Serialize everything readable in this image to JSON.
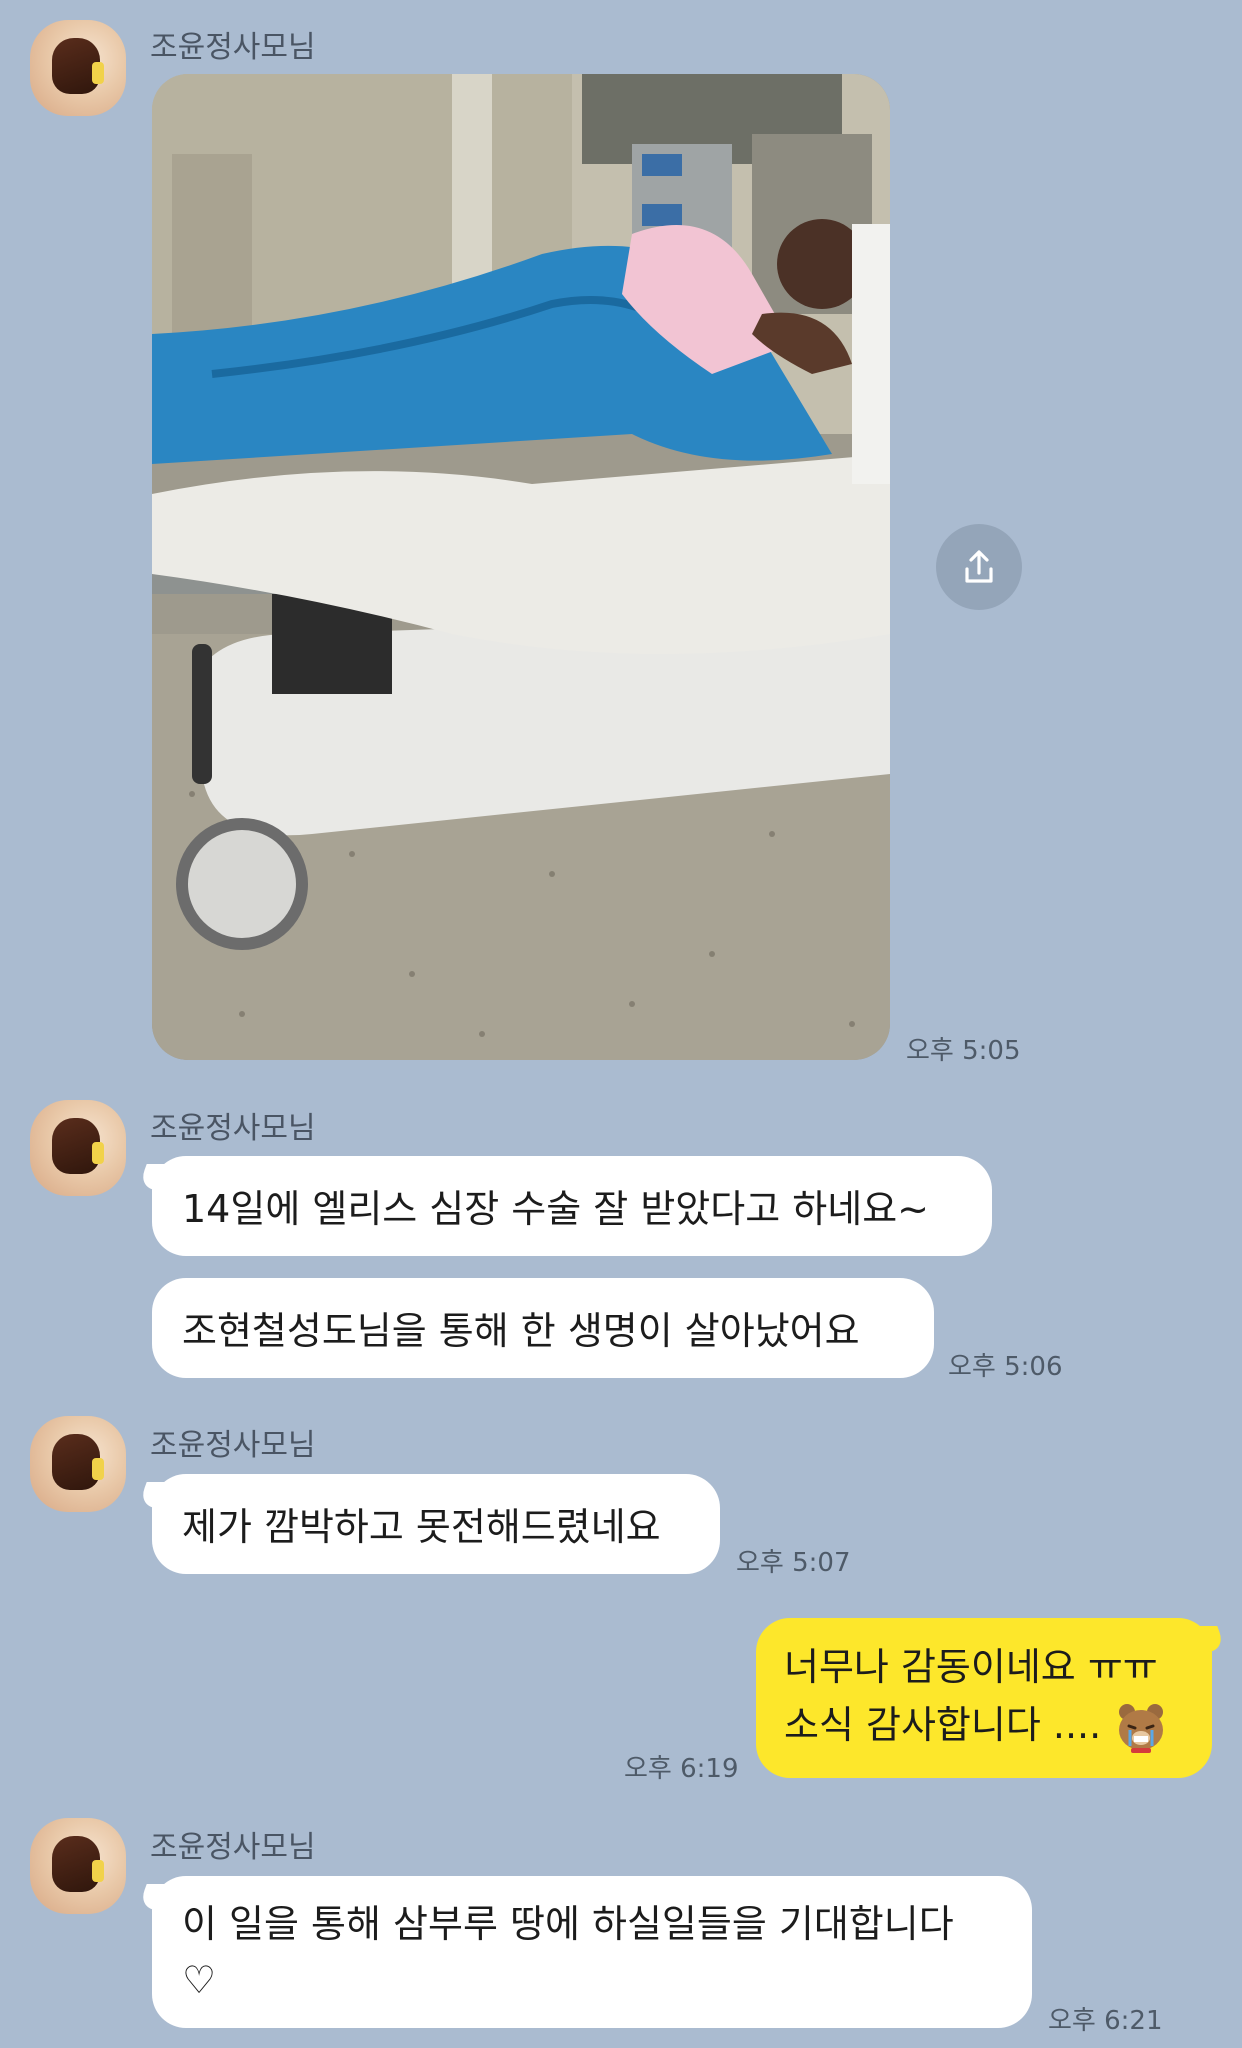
{
  "chat": {
    "sender_name": "조윤정사모님",
    "messages": [
      {
        "type": "image",
        "time": "오후 5:05"
      },
      {
        "lines": [
          "14일에 엘리스 심장 수술 잘 받았다고 하네요~"
        ]
      },
      {
        "lines": [
          "조현철성도님을 통해 한 생명이 살아났어요"
        ],
        "time": "오후 5:06"
      },
      {
        "lines": [
          "제가 깜박하고 못전해드렸네요"
        ],
        "time": "오후 5:07"
      },
      {
        "lines": [
          "너무나 감동이네요 ㅠㅠ",
          "소식 감사합니다 ...."
        ],
        "time": "오후 6:19"
      },
      {
        "lines": [
          "이 일을 통해 삼부루 땅에 하실일들을 기대합니다",
          "♡"
        ],
        "time": "오후 6:21"
      }
    ]
  },
  "icons": {
    "share": "share-icon",
    "emoticon": "crying-bear-emoticon"
  },
  "colors": {
    "background": "#aabbd0",
    "my_bubble": "#fde72b",
    "their_bubble": "#ffffff"
  }
}
